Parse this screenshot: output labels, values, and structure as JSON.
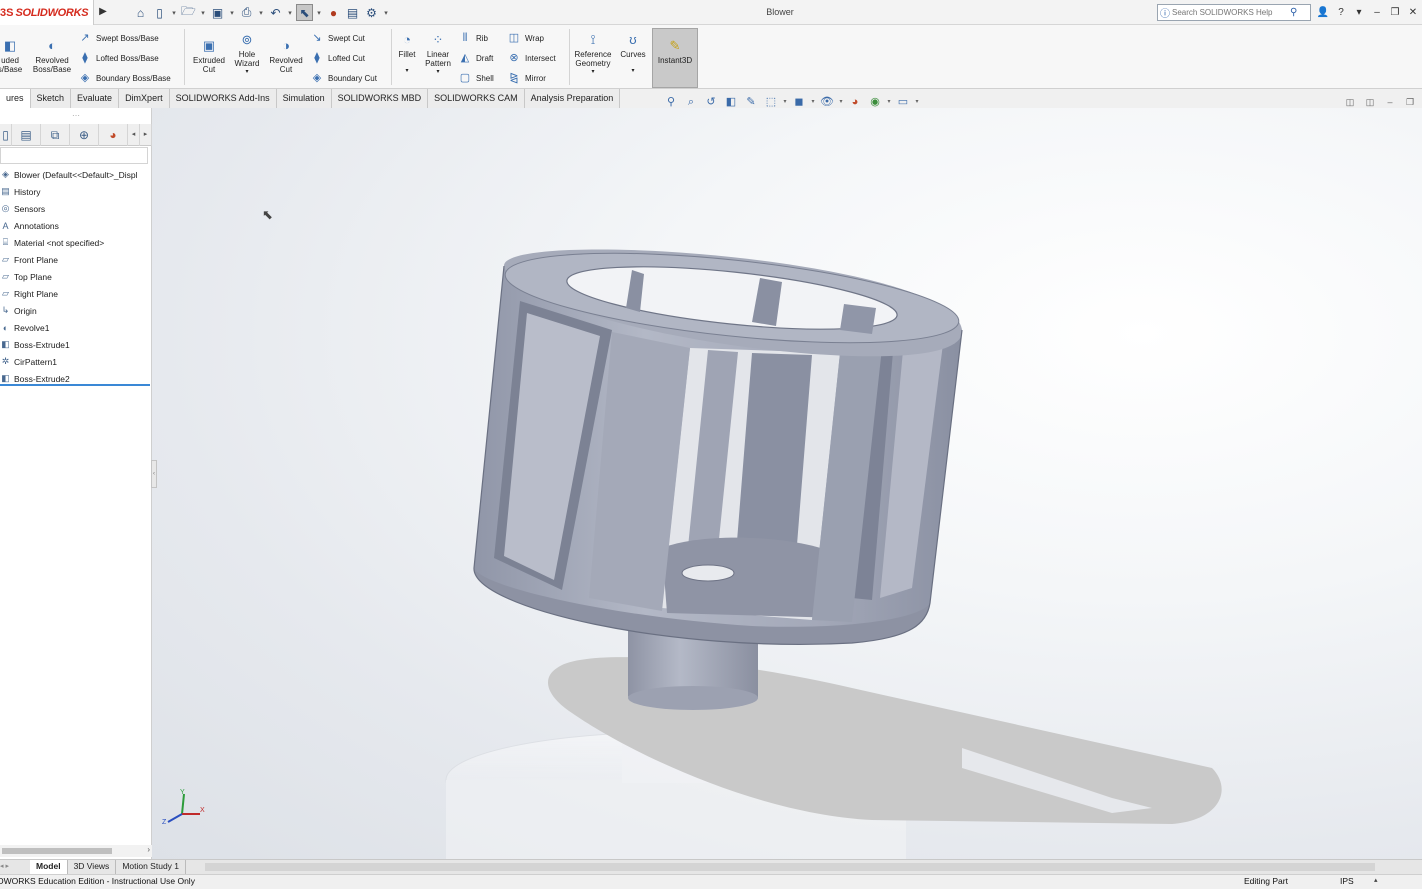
{
  "app": {
    "logo_ds": "3S",
    "logo_name": "SOLIDWORKS",
    "doc_title": "Blower",
    "search_placeholder": "Search SOLIDWORKS Help"
  },
  "quick_access": [
    "home-icon",
    "new-document-icon",
    "open-icon",
    "save-icon",
    "print-icon",
    "undo-icon",
    "select-icon",
    "rebuild-icon",
    "file-properties-icon",
    "options-icon"
  ],
  "command_manager": {
    "extruded_boss": "Extruded\nBoss/Base",
    "extruded_boss_visible": "uded\ns/Base",
    "revolved_boss": "Revolved\nBoss/Base",
    "swept_boss": "Swept Boss/Base",
    "lofted_boss": "Lofted Boss/Base",
    "boundary_boss": "Boundary Boss/Base",
    "extruded_cut": "Extruded\nCut",
    "hole_wizard": "Hole\nWizard",
    "revolved_cut": "Revolved\nCut",
    "swept_cut": "Swept Cut",
    "lofted_cut": "Lofted Cut",
    "boundary_cut": "Boundary Cut",
    "fillet": "Fillet",
    "linear_pattern": "Linear\nPattern",
    "rib": "Rib",
    "draft": "Draft",
    "shell": "Shell",
    "wrap": "Wrap",
    "intersect": "Intersect",
    "mirror": "Mirror",
    "reference_geometry": "Reference\nGeometry",
    "curves": "Curves",
    "instant3d": "Instant3D"
  },
  "command_tabs": [
    {
      "label": "ures",
      "active": true
    },
    {
      "label": "Sketch",
      "active": false
    },
    {
      "label": "Evaluate",
      "active": false
    },
    {
      "label": "DimXpert",
      "active": false
    },
    {
      "label": "SOLIDWORKS Add-Ins",
      "active": false
    },
    {
      "label": "Simulation",
      "active": false
    },
    {
      "label": "SOLIDWORKS MBD",
      "active": false
    },
    {
      "label": "SOLIDWORKS CAM",
      "active": false
    },
    {
      "label": "Analysis Preparation",
      "active": false
    }
  ],
  "feature_tree": [
    {
      "label": "Blower  (Default<<Default>_Displ",
      "icon": "part-icon"
    },
    {
      "label": "History",
      "icon": "history-icon"
    },
    {
      "label": "Sensors",
      "icon": "sensor-icon"
    },
    {
      "label": "Annotations",
      "icon": "annotation-icon"
    },
    {
      "label": "Material <not specified>",
      "icon": "material-icon"
    },
    {
      "label": "Front Plane",
      "icon": "plane-icon"
    },
    {
      "label": "Top Plane",
      "icon": "plane-icon"
    },
    {
      "label": "Right Plane",
      "icon": "plane-icon"
    },
    {
      "label": "Origin",
      "icon": "origin-icon"
    },
    {
      "label": "Revolve1",
      "icon": "revolve-feature-icon"
    },
    {
      "label": "Boss-Extrude1",
      "icon": "extrude-feature-icon"
    },
    {
      "label": "CirPattern1",
      "icon": "circular-pattern-icon"
    },
    {
      "label": "Boss-Extrude2",
      "icon": "extrude-feature-icon"
    }
  ],
  "bottom_tabs": [
    {
      "label": "Model",
      "active": true
    },
    {
      "label": "3D Views",
      "active": false
    },
    {
      "label": "Motion Study 1",
      "active": false
    }
  ],
  "status": {
    "left": "OWORKS Education Edition - Instructional Use Only",
    "mode": "Editing Part",
    "units": "IPS"
  },
  "colors": {
    "brand_red": "#d52b1e",
    "model_face": "#a8adbd",
    "model_dark": "#7e8496",
    "rollback_bar": "#3a88d6"
  }
}
